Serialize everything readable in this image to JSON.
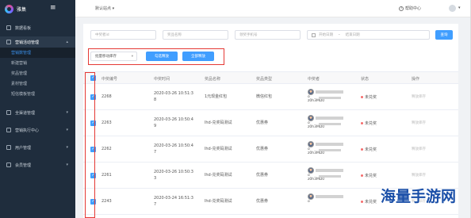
{
  "brand": {
    "logo_text": "雅集"
  },
  "topbar": {
    "site_select": "默认站点 ▾",
    "help": "帮助中心"
  },
  "sidebar": {
    "items": [
      {
        "label": "数据看板"
      },
      {
        "label": "营销活动管理",
        "open": true
      },
      {
        "label": "全渠道管理"
      },
      {
        "label": "营销执行中心"
      },
      {
        "label": "用户管理"
      },
      {
        "label": "会员管理"
      }
    ],
    "sub_items": [
      {
        "label": "营销数管理",
        "active": true
      },
      {
        "label": "新建营销"
      },
      {
        "label": "奖品管理"
      },
      {
        "label": "素材管理"
      },
      {
        "label": "短信模板管理"
      }
    ]
  },
  "filters": {
    "winner_no": "中奖者id",
    "prize_name": "奖品名称",
    "phone": "领奖手机号",
    "start_date": "开始日期",
    "date_sep": "-",
    "end_date": "结束日期",
    "query_button": "查询"
  },
  "batch": {
    "select_value": "批量移动库存",
    "checked_button": "勾选释放",
    "all_button": "全部释放"
  },
  "table": {
    "columns": [
      "中奖编号",
      "中奖时间",
      "奖品名称",
      "奖品类型",
      "中奖者",
      "状态",
      "操作"
    ],
    "rows": [
      {
        "id": "2268",
        "time": [
          "2020-03-26 10:51:3",
          "8"
        ],
        "prize": "1元现金红包",
        "type": "微信红包",
        "winner_text": [
          "o",
          "z0h3MD0"
        ],
        "status": "未兑奖",
        "action": "释放库存"
      },
      {
        "id": "2263",
        "time": [
          "2020-03-26 10:50:4",
          "9"
        ],
        "prize": "lhd-兑奖码测试",
        "type": "优惠券",
        "winner_text": [
          "o",
          "z0h3MD0"
        ],
        "status": "未兑奖",
        "action": "释放库存"
      },
      {
        "id": "2262",
        "time": [
          "2020-03-26 10:50:4",
          "7"
        ],
        "prize": "lhd-兑奖码测试",
        "type": "优惠券",
        "winner_text": [
          "o",
          "z0h3MD0"
        ],
        "status": "未兑奖",
        "action": "释放库存"
      },
      {
        "id": "2261",
        "time": [
          "2020-03-26 10:50:3",
          "3"
        ],
        "prize": "lhd-兑奖码测试",
        "type": "优惠券",
        "winner_text": [
          "o",
          "z0h3MD0"
        ],
        "status": "未兑奖",
        "action": "释放库存"
      },
      {
        "id": "2243",
        "time": [
          "2020-03-24 16:51:3",
          "7"
        ],
        "prize": "lhd-兑奖码测试",
        "type": "优惠券",
        "winner_text": [
          "o",
          ""
        ],
        "status": "未兑奖",
        "action": "释放库存"
      }
    ]
  },
  "watermark": {
    "text": "海量手游网"
  },
  "colors": {
    "primary": "#409eff",
    "sidebar_bg": "#1f2d3d",
    "highlight": "#e53935",
    "status_dot": "#f56c6c"
  }
}
